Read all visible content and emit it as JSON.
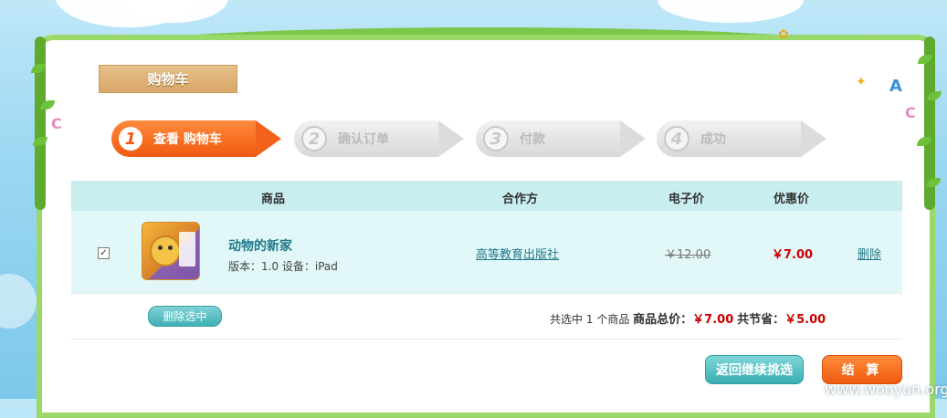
{
  "title": "购物车",
  "steps": [
    {
      "num": "1",
      "label": "查看 购物车"
    },
    {
      "num": "2",
      "label": "确认订单"
    },
    {
      "num": "3",
      "label": "付款"
    },
    {
      "num": "4",
      "label": "成功"
    }
  ],
  "table": {
    "headers": {
      "product": "商品",
      "partner": "合作方",
      "eprice": "电子价",
      "discount": "优惠价"
    },
    "item": {
      "checked": "✓",
      "name": "动物的新家",
      "meta": "版本：1.0 设备：iPad",
      "partner": "高等教育出版社",
      "eprice": "￥12.00",
      "discount": "￥7.00",
      "delete": "删除"
    }
  },
  "actions": {
    "delete_selected": "删除选中"
  },
  "summary": {
    "selected_prefix": "共选中",
    "selected_count": "1",
    "selected_suffix": "个商品",
    "total_label": "商品总价：",
    "total": "￥7.00",
    "save_label": "共节省：",
    "save": "￥5.00"
  },
  "buttons": {
    "back": "返回继续挑选",
    "checkout": "结 算"
  },
  "watermark": "www.wooyun.org"
}
